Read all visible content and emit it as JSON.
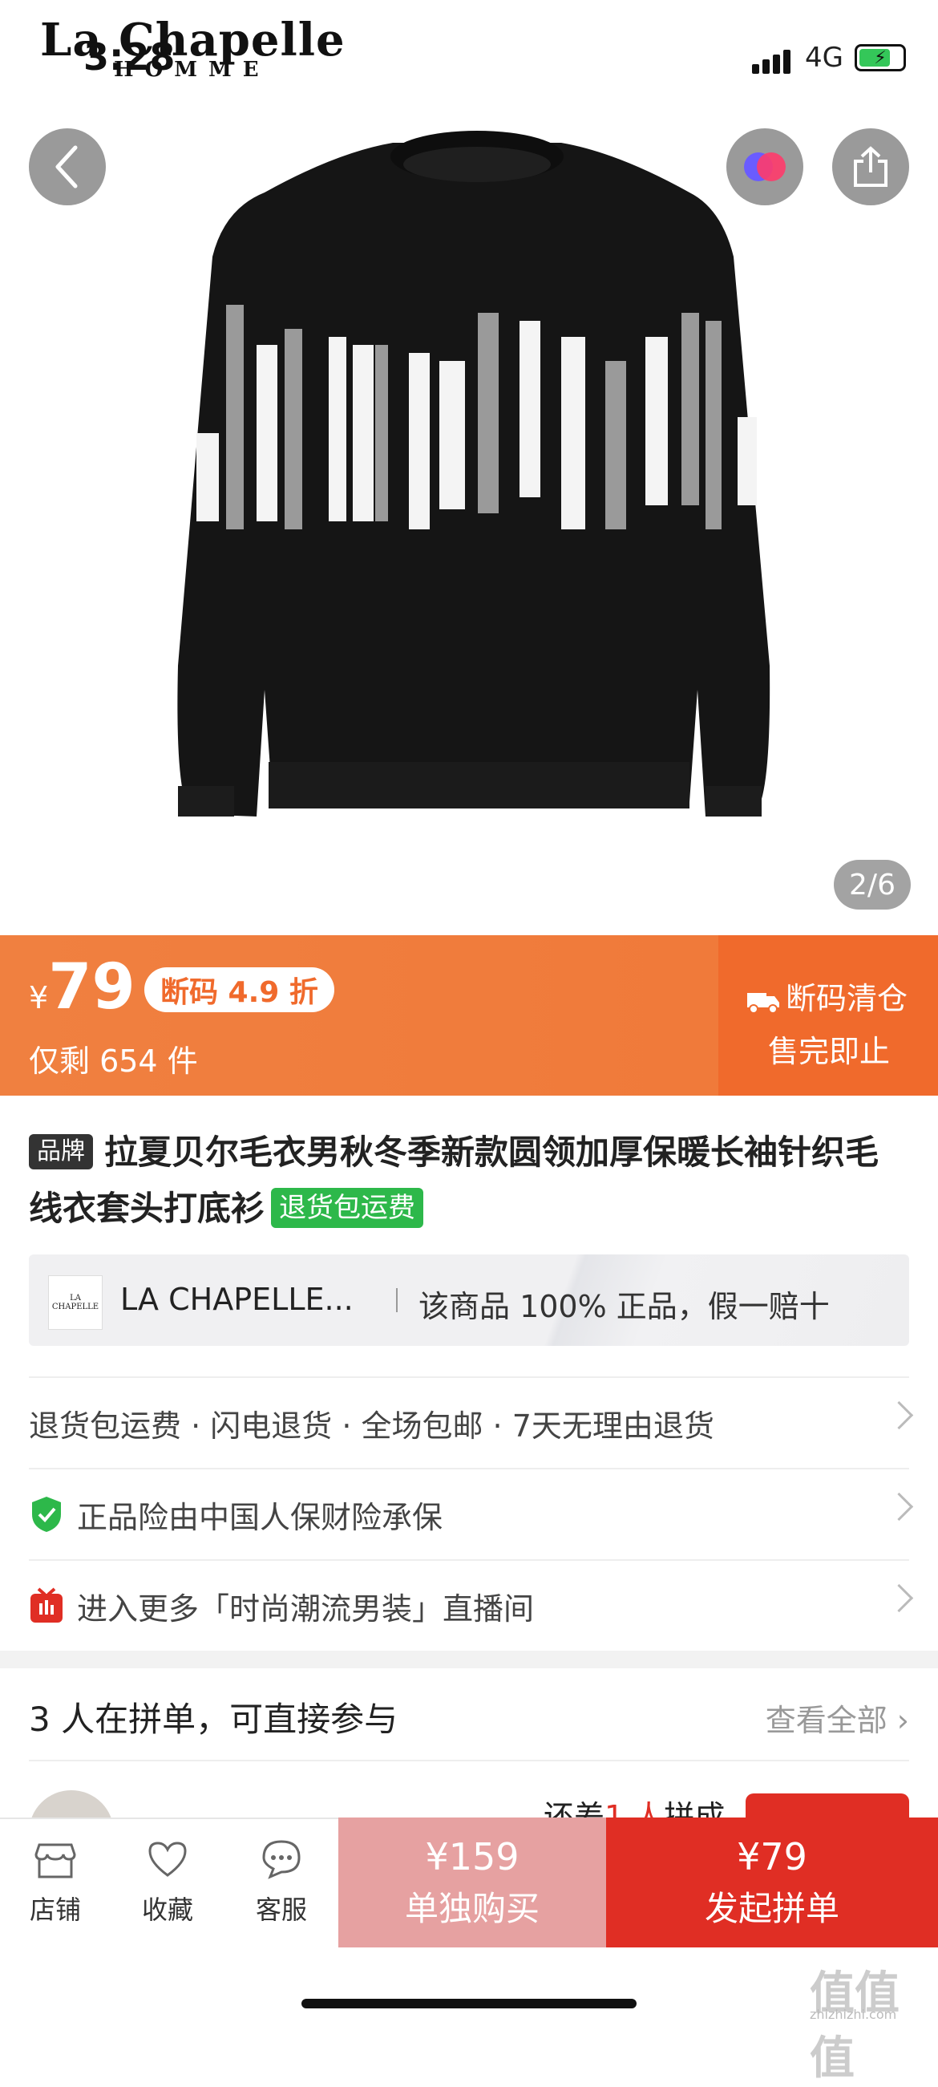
{
  "status": {
    "time": "3:28",
    "network": "4G"
  },
  "hero": {
    "brand_main": "La Chapelle",
    "brand_sub": "HOMME",
    "counter": "2/6",
    "icons": {
      "back": "chevron-left-icon",
      "merge": "two-circles-icon",
      "share": "share-icon"
    }
  },
  "price_banner": {
    "currency": "¥",
    "price": "79",
    "discount": "断码 4.9 折",
    "stock": "仅剩 654 件",
    "clearance_line1": "断码清仓",
    "clearance_line2": "售完即止"
  },
  "product": {
    "brand_tag": "品牌",
    "title": "拉夏贝尔毛衣男秋冬季新款圆领加厚保暖长袖针织毛线衣套头打底衫",
    "return_tag": "退货包运费"
  },
  "brand_strip": {
    "name": "LA CHAPELLE...",
    "claim": "该商品 100% 正品，假一赔十"
  },
  "rows": {
    "services": "退货包运费 · 闪电退货 · 全场包邮 · 7天无理由退货",
    "insurance": "正品险由中国人保财险承保",
    "live": "进入更多「时尚潮流男装」直播间"
  },
  "group_buy": {
    "title": "3 人在拼单，可直接参与",
    "view_all": "查看全部",
    "need_prefix": "还差",
    "need_count": "1 人",
    "need_suffix": "拼成"
  },
  "bottom_bar": {
    "shop": "店铺",
    "favorite": "收藏",
    "service": "客服",
    "solo_price": "¥159",
    "solo_label": "单独购买",
    "group_price": "¥79",
    "group_label": "发起拼单"
  },
  "watermark": {
    "main": "值值值",
    "sub": "zhizhizhi.com"
  },
  "colors": {
    "accent": "#e02e24",
    "banner": "#f07838",
    "green": "#2db84a"
  }
}
